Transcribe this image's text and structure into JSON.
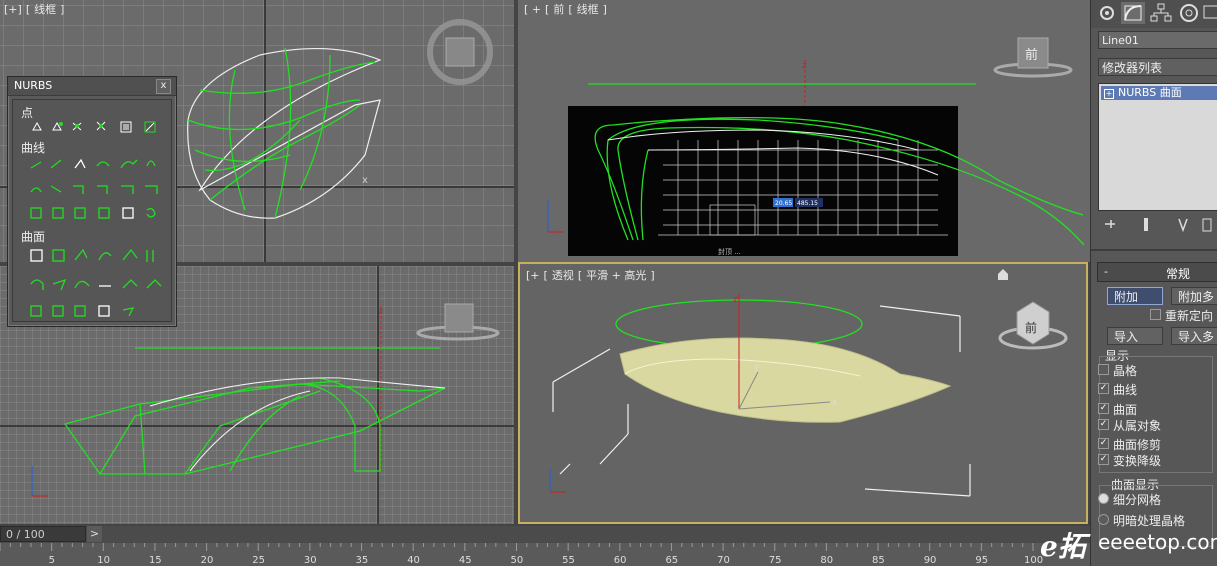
{
  "viewports": {
    "top": {
      "labels": [
        "[+]",
        "[",
        "线框",
        "]"
      ],
      "axis_x": "x"
    },
    "front": {
      "labels": [
        "[ +",
        "[",
        "前",
        "[",
        "线框",
        "]"
      ],
      "cube_label": "前",
      "axis": "z",
      "ref_caption": "封顶 ...",
      "ref_tags": [
        "20.65",
        "485.15"
      ]
    },
    "left": {
      "labels": [],
      "axis": "z"
    },
    "perspective": {
      "labels": [
        "[+",
        "[",
        "透视",
        "[",
        "平滑 + 高光",
        "]"
      ],
      "cube_label": "前",
      "axis_y": "y",
      "axis_x": "x",
      "axis_z": "z"
    }
  },
  "nurbs_panel": {
    "title": "NURBS",
    "close": "x",
    "sections": {
      "points": "点",
      "curves": "曲线",
      "surfaces": "曲面"
    }
  },
  "right_panel": {
    "object_name": "Line01",
    "modifier_list": "修改器列表",
    "stack_item": "NURBS 曲面",
    "rollout_title": "常规",
    "attach": "附加",
    "attach_multi": "附加多",
    "reorient": "重新定向",
    "import": "导入",
    "import_multi": "导入多",
    "display_title": "显示",
    "display_items": [
      {
        "label": "晶格",
        "checked": false
      },
      {
        "label": "曲线",
        "checked": true
      },
      {
        "label": "曲面",
        "checked": true
      },
      {
        "label": "从属对象",
        "checked": true
      },
      {
        "label": "曲面修剪",
        "checked": true
      },
      {
        "label": "变换降级",
        "checked": true
      }
    ],
    "surface_display_title": "曲面显示",
    "surface_display_options": [
      {
        "label": "细分网格",
        "selected": true
      },
      {
        "label": "明暗处理晶格",
        "selected": false
      }
    ]
  },
  "timeline": {
    "frame_counter": "0 / 100",
    "next": ">",
    "ticks": [
      "5",
      "10",
      "15",
      "20",
      "25",
      "30",
      "35",
      "40",
      "45",
      "50",
      "55",
      "60",
      "65",
      "70",
      "75",
      "80",
      "85",
      "90",
      "95",
      "100"
    ]
  },
  "watermark": {
    "logo": "e拓",
    "text": "eeeetop.com"
  },
  "colors": {
    "wire_green": "#22e022",
    "wire_white": "#f0f0f0",
    "grid": "#8a8a8a",
    "axis_red": "#d02020",
    "active_border": "#c8b060",
    "surface": "#d8d8a0"
  }
}
